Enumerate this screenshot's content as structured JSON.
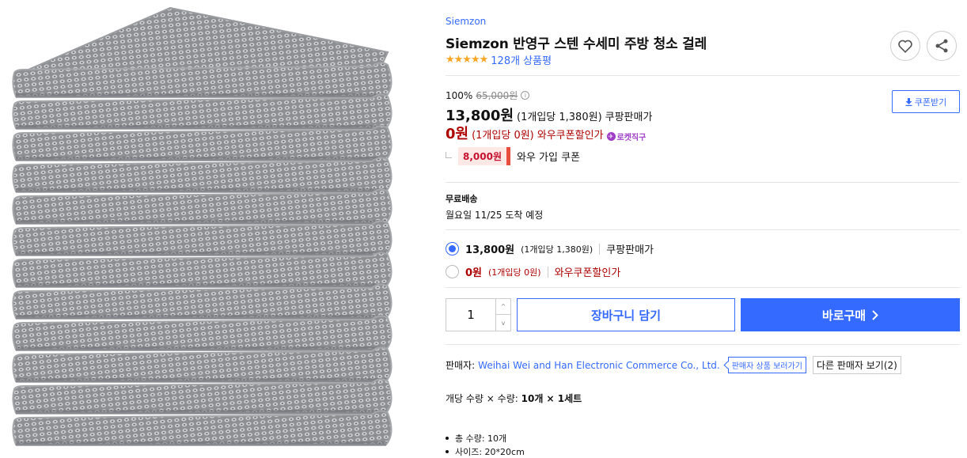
{
  "product": {
    "brand": "Siemzon",
    "title": "Siemzon 반영구 스텐 수세미 주방 청소 걸레",
    "rating_stars": "★★★★★",
    "rating_value": 4.5,
    "review_count": "128개 상품평"
  },
  "pricing": {
    "discount_rate": "100%",
    "original_price": "65,000원",
    "sale_price": "13,800원",
    "sale_unit_price": "(1개입당 1,380원)",
    "sale_label": "쿠팡판매가",
    "wow_price": "0원",
    "wow_unit_price": "(1개입당 0원)",
    "wow_label": "와우쿠폰할인가",
    "rocket_label": "로켓직구",
    "coupon_amount": "8,000원",
    "coupon_label": "와우 가입 쿠폰",
    "coupon_download_label": "쿠폰받기"
  },
  "shipping": {
    "title": "무료배송",
    "arrival": "월요일 11/25 도착 예정"
  },
  "options": [
    {
      "price": "13,800원",
      "unit": "(1개입당 1,380원)",
      "label": "쿠팡판매가",
      "selected": true
    },
    {
      "price": "0원",
      "unit": "(1개입당 0원)",
      "label": "와우쿠폰할인가",
      "selected": false
    }
  ],
  "purchase": {
    "quantity": "1",
    "cart_label": "장바구니 담기",
    "buy_label": "바로구매"
  },
  "seller": {
    "prefix": "판매자:",
    "name": "Weihai Wei and Han Electronic Commerce Co., Ltd.",
    "products_tag": "판매자 상품 보러가기",
    "other_sellers": "다른 판매자 보기(2)"
  },
  "details": {
    "qty_prefix": "개당 수량 × 수량:",
    "qty_value": "10개 × 1세트",
    "bullets": [
      "총 수량: 10개",
      "사이즈: 20*20cm"
    ]
  },
  "colors": {
    "accent": "#346aff",
    "wow_red": "#ae0000",
    "star": "#f5a623"
  }
}
